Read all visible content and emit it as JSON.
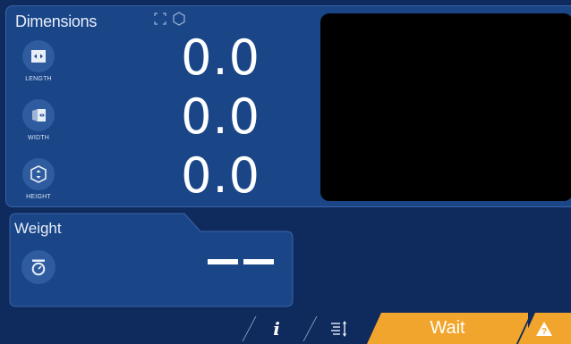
{
  "dimensions": {
    "title": "Dimensions",
    "rows": [
      {
        "label": "LENGTH",
        "value": "0.0",
        "icon": "length-icon"
      },
      {
        "label": "WIDTH",
        "value": "0.0",
        "icon": "width-icon"
      },
      {
        "label": "HEIGHT",
        "value": "0.0",
        "icon": "height-icon"
      }
    ],
    "title_icons": [
      "box-outline-icon",
      "hexagon-icon"
    ]
  },
  "weight": {
    "title": "Weight",
    "icon": "scale-icon",
    "value_display": "dashes"
  },
  "bottom_bar": {
    "info_label": "i",
    "list_icon": "sort-list-icon",
    "wait_label": "Wait",
    "warning_icon": "warning-question-icon"
  },
  "colors": {
    "background": "#0f2a5c",
    "panel": "#1a4688",
    "accent": "#f2a52c",
    "camera": "#000000"
  }
}
